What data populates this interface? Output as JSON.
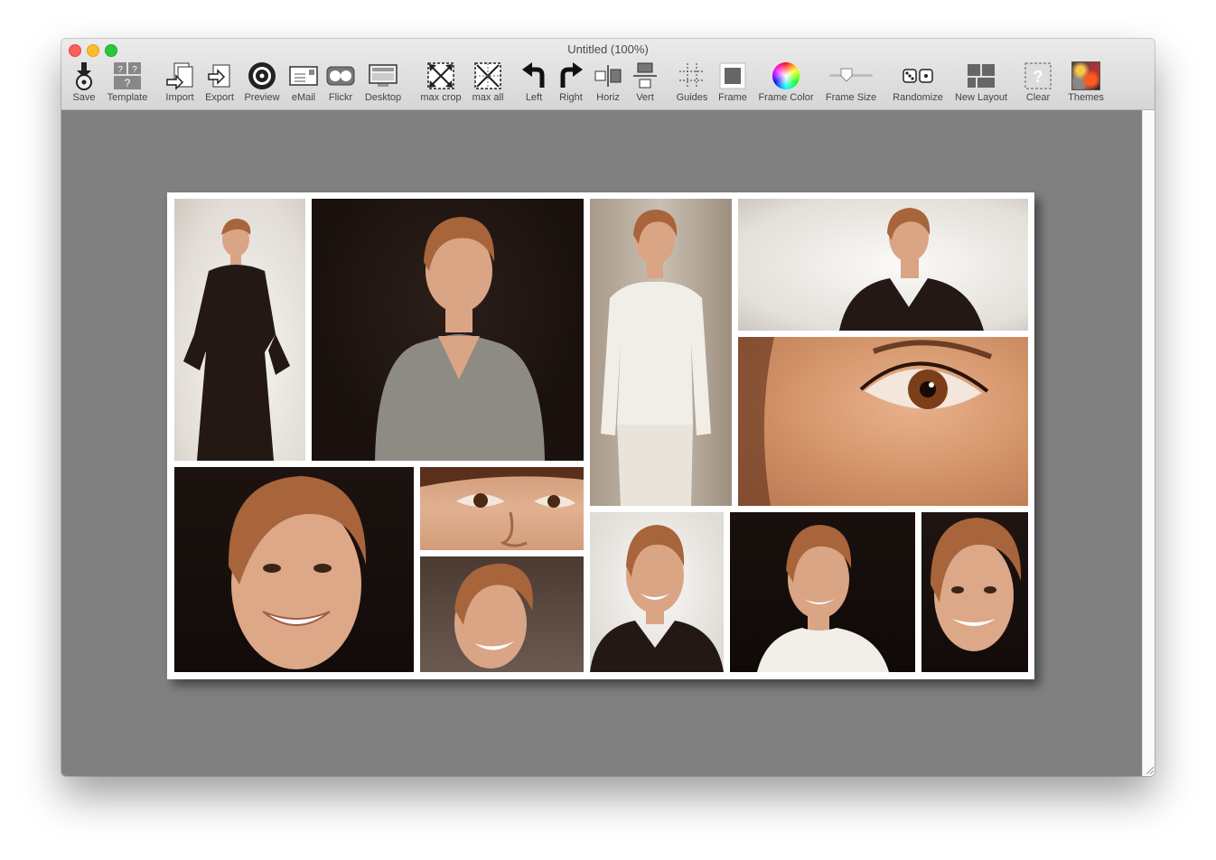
{
  "window": {
    "title": "Untitled (100%)"
  },
  "toolbar": {
    "save": "Save",
    "template": "Template",
    "import": "Import",
    "export": "Export",
    "preview": "Preview",
    "email": "eMail",
    "flickr": "Flickr",
    "desktop": "Desktop",
    "max_crop": "max crop",
    "max_all": "max all",
    "left": "Left",
    "right": "Right",
    "horiz": "Horiz",
    "vert": "Vert",
    "guides": "Guides",
    "frame": "Frame",
    "frame_color": "Frame Color",
    "frame_size": "Frame Size",
    "frame_size_level": 0.35,
    "randomize": "Randomize",
    "new_layout": "New Layout",
    "clear": "Clear",
    "themes": "Themes"
  },
  "colors": {
    "canvas_bg": "#808080",
    "frame": "#ffffff",
    "dark_backdrop": "#1f1512",
    "light_backdrop": "#e6e2dc",
    "skin": "#d9a585",
    "hair": "#a8643a"
  }
}
